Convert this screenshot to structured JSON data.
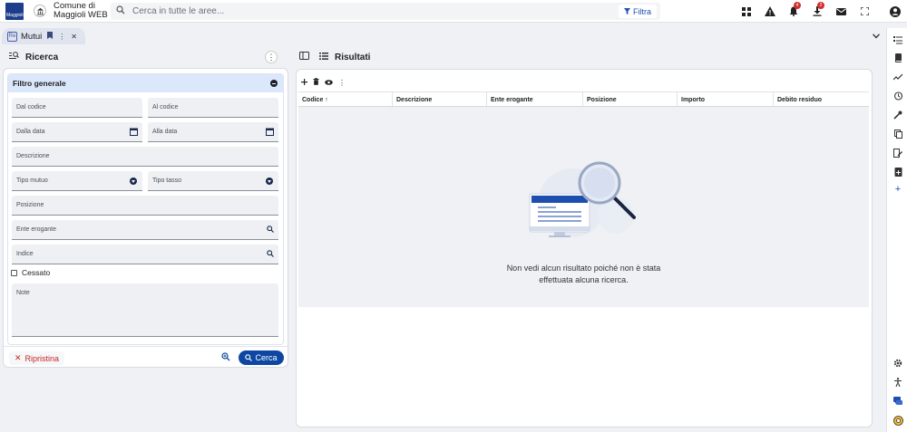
{
  "header": {
    "logo_text": "Maggioli",
    "app_title_line1": "Comune di",
    "app_title_line2": "Maggioli WEB",
    "search_placeholder": "Cerca in tutte le aree...",
    "filter_label": "Filtra",
    "notifications_count": "4",
    "downloads_count": "2"
  },
  "tab": {
    "label": "Mutui"
  },
  "left": {
    "title": "Ricerca",
    "filter_group_title": "Filtro generale",
    "fields": {
      "dal_codice": "Dal codice",
      "al_codice": "Al codice",
      "dalla_data": "Dalla data",
      "alla_data": "Alla data",
      "descrizione": "Descrizione",
      "tipo_mutuo": "Tipo mutuo",
      "tipo_tasso": "Tipo tasso",
      "posizione": "Posizione",
      "ente_erogante": "Ente erogante",
      "indice": "Indice",
      "cessato": "Cessato",
      "note": "Note"
    },
    "reset_label": "Ripristina",
    "search_label": "Cerca"
  },
  "right": {
    "title": "Risultati",
    "columns": [
      "Codice ↑",
      "Descrizione",
      "Ente erogante",
      "Posizione",
      "Importo",
      "Debito residuo"
    ],
    "empty_line1": "Non vedi alcun risultato poiché non è stata",
    "empty_line2": "effettuata alcuna ricerca."
  },
  "colors": {
    "primary": "#0d47a1",
    "filter_head_bg": "#dbe8fb",
    "danger": "#c62828",
    "badge": "#d32f2f"
  }
}
